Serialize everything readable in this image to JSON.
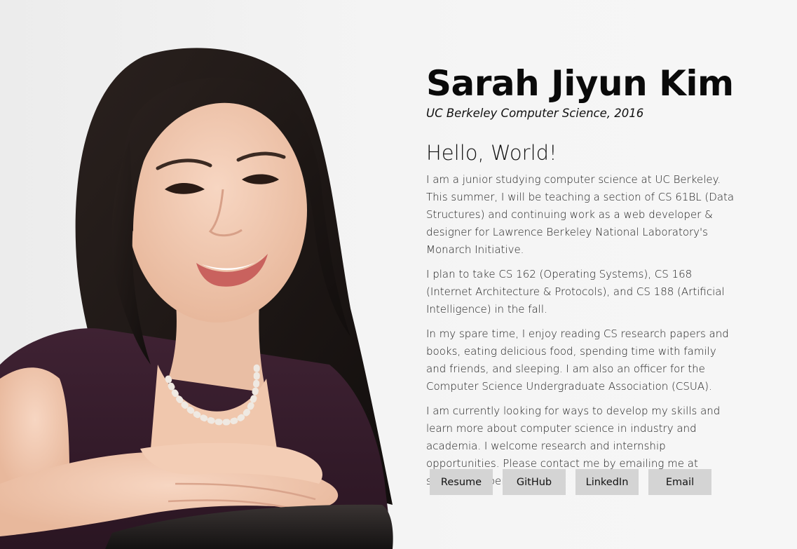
{
  "profile": {
    "name": "Sarah Jiyun Kim",
    "subtitle": "UC Berkeley Computer Science, 2016",
    "greeting": "Hello, World!"
  },
  "paragraphs": [
    "I am a junior studying computer science at UC Berkeley. This summer, I will be teaching a section of CS 61BL (Data Structures) and continuing work as a web developer & designer for Lawrence Berkeley National Laboratory's Monarch Initiative.",
    "I plan to take CS 162 (Operating Systems), CS 168 (Internet Architecture & Protocols), and CS 188 (Artificial Intelligence) in the fall.",
    "In my spare time, I enjoy reading CS research papers and books, eating delicious food, spending time with family and friends, and sleeping. I am also an officer for the Computer Science Undergraduate Association (CSUA).",
    "I am currently looking for ways to develop my skills and learn more about computer science in industry and academia. I welcome research and internship opportunities. Please contact me by emailing me at sarahjkim@berkeley.edu."
  ],
  "buttons": {
    "resume": "Resume",
    "github": "GitHub",
    "linkedin": "LinkedIn",
    "email": "Email"
  },
  "colors": {
    "background": "#f2f2f2",
    "button_bg": "#d4d4d4",
    "hair": "#1c1614",
    "skin": "#f0c8ae",
    "top": "#3a1f2e"
  }
}
